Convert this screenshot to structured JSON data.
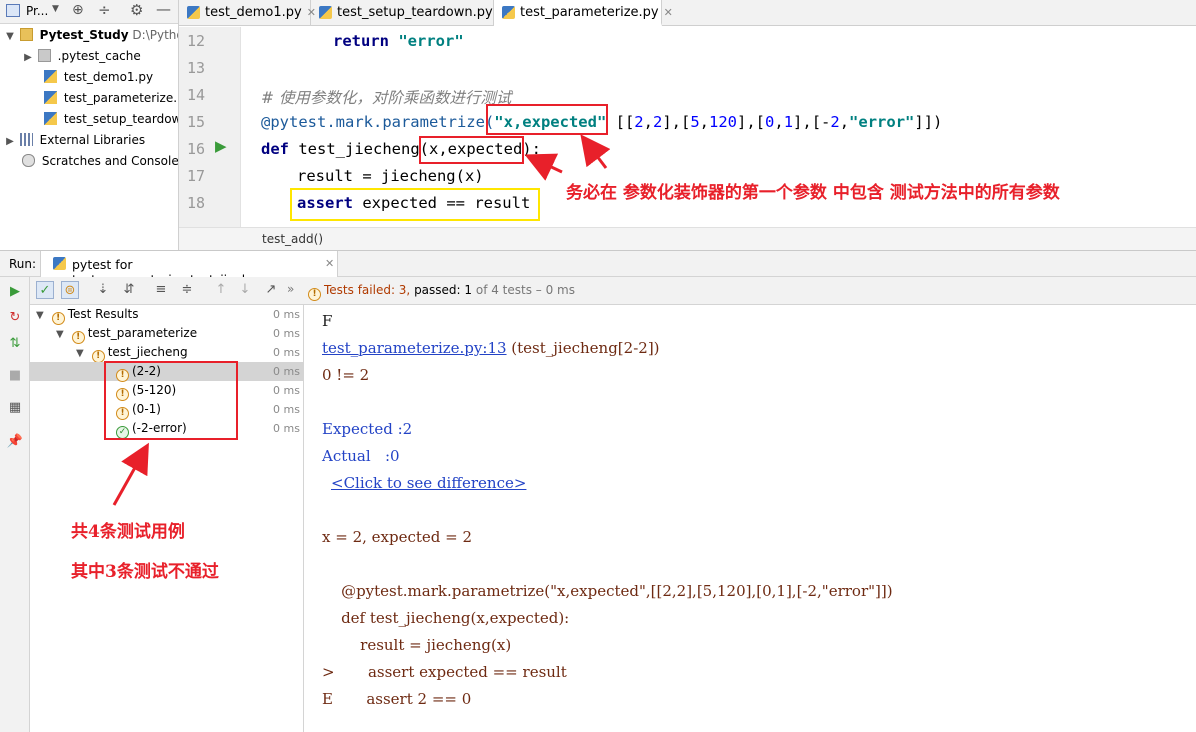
{
  "project": {
    "toolbar_label": "Pr...",
    "root_name": "Pytest_Study",
    "root_path": "D:\\Pythor",
    "items": [
      ".pytest_cache",
      "test_demo1.py",
      "test_parameterize.py",
      "test_setup_teardown"
    ],
    "external": "External Libraries",
    "scratches": "Scratches and Consoles"
  },
  "editor": {
    "tabs": [
      "test_demo1.py",
      "test_setup_teardown.py",
      "test_parameterize.py"
    ],
    "active_tab": 2,
    "line_numbers": [
      "12",
      "13",
      "14",
      "15",
      "16",
      "17",
      "18"
    ],
    "lines": {
      "l12_kw": "return",
      "l12_str": "\"error\"",
      "l14_comment": "# 使用参数化，对阶乘函数进行测试",
      "l15_deco": "@pytest.mark.parametrize(",
      "l15_str": "\"x,expected\"",
      "l15_rest_a": " [[",
      "l15_n1": "2",
      "l15_c1": ",",
      "l15_n2": "2",
      "l15_c2": "],[",
      "l15_n3": "5",
      "l15_c3": ",",
      "l15_n4": "120",
      "l15_c4": "],[",
      "l15_n5": "0",
      "l15_c5": ",",
      "l15_n6": "1",
      "l15_c6": "],[-",
      "l15_n7": "2",
      "l15_c7": ",",
      "l15_str2": "\"error\"",
      "l15_end": "]])",
      "l16_kw": "def",
      "l16_name": " test_jiecheng",
      "l16_params": "(x,expected)",
      "l16_colon": ":",
      "l17": "result = jiecheng(x)",
      "l18_kw": "assert",
      "l18_rest": " expected == result"
    },
    "breadcrumb": "test_add()"
  },
  "run": {
    "label": "Run:",
    "config": "pytest for test_parameterize.test_jiecheng",
    "status_failed": "Tests failed: 3,",
    "status_passed": " passed: 1",
    "status_total": " of 4 tests – 0 ms"
  },
  "tree": {
    "rows": [
      {
        "label": "Test Results",
        "ms": "0 ms"
      },
      {
        "label": "test_parameterize",
        "ms": "0 ms"
      },
      {
        "label": "test_jiecheng",
        "ms": "0 ms"
      },
      {
        "label": "(2-2)",
        "ms": "0 ms"
      },
      {
        "label": "(5-120)",
        "ms": "0 ms"
      },
      {
        "label": "(0-1)",
        "ms": "0 ms"
      },
      {
        "label": "(-2-error)",
        "ms": "0 ms"
      }
    ]
  },
  "console": {
    "l1": "F",
    "l2_link": "test_parameterize.py:13",
    "l2_rest": " (test_jiecheng[2-2])",
    "l3": "0 != 2",
    "l4": "Expected :2",
    "l5": "Actual   :0",
    "l6_link": "<Click to see difference>",
    "l7": "x = 2, expected = 2",
    "l8": "    @pytest.mark.parametrize(\"x,expected\",[[2,2],[5,120],[0,1],[-2,\"error\"]])",
    "l9": "    def test_jiecheng(x,expected):",
    "l10": "        result = jiecheng(x)",
    "l11": ">       assert expected == result",
    "l12": "E       assert 2 == 0"
  },
  "annotations": {
    "note1": "务必在 参数化装饰器的第一个参数 中包含 测试方法中的所有参数",
    "note2": "共4条测试用例",
    "note3": "其中3条测试不通过"
  },
  "colors": {
    "annotation_red": "#e8202a",
    "highlight_yellow": "#ffe600",
    "keyword": "#000080",
    "string": "#008080"
  }
}
